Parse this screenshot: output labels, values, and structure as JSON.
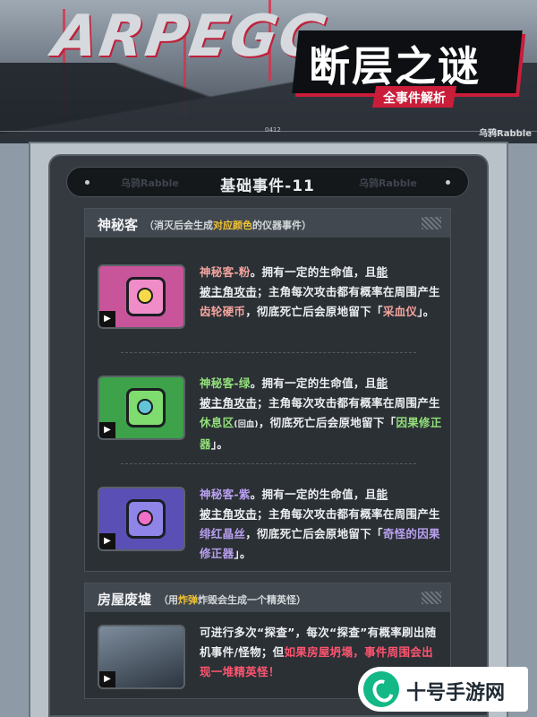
{
  "banner": {
    "logo": "ARPEGG",
    "title": "断层之谜",
    "subtitle": "全事件解析",
    "author": "乌鸦Rabble",
    "code": "0412"
  },
  "section": {
    "title": "基础事件-11",
    "watermark": "乌鸦Rabble"
  },
  "card1": {
    "name": "神秘客",
    "note_pre": "（消灭后会生成",
    "note_hl": "对应颜色",
    "note_post": "的仪器事件）",
    "entries": [
      {
        "name": "神秘客-粉",
        "t1": "。拥有一定的生命值，且",
        "u1": "能",
        "line2": "被主角攻击",
        "t2": "；主角每次攻击都有概率在周围产生",
        "h": "齿轮硬币",
        "t3": "，彻底死亡后会原地留下「",
        "u2": "采血仪",
        "t4": "」。"
      },
      {
        "name": "神秘客-绿",
        "t1": "。拥有一定的生命值，且",
        "u1": "能",
        "line2": "被主角攻击",
        "t2": "；主角每次攻击都有概率在周围产生",
        "h": "休息区",
        "tiny": "(回血)",
        "t3": "，彻底死亡后会原地留下「",
        "u2": "因果修正器",
        "t4": "」。"
      },
      {
        "name": "神秘客-紫",
        "t1": "。拥有一定的生命值，且",
        "u1": "能",
        "line2": "被主角攻击",
        "t2": "；主角每次攻击都有概率在周围产生",
        "h": "绯红晶丝",
        "t3": "，彻底死亡后会原地留下「",
        "u2": "奇怪的因果修正器",
        "t4": "」。"
      }
    ]
  },
  "card2": {
    "name": "房屋废墟",
    "note_pre": "（用",
    "note_hl": "炸弹",
    "note_post": "炸毁会生成一个精英怪）",
    "p1": "可进行多次“探查”，每次“探查”有概率刷出随机事件/怪物；但",
    "red": "如果房屋坍塌，事件周围会出现一堆精英怪",
    "end": "！"
  },
  "watermark_badge": {
    "text": "十号手游网"
  }
}
